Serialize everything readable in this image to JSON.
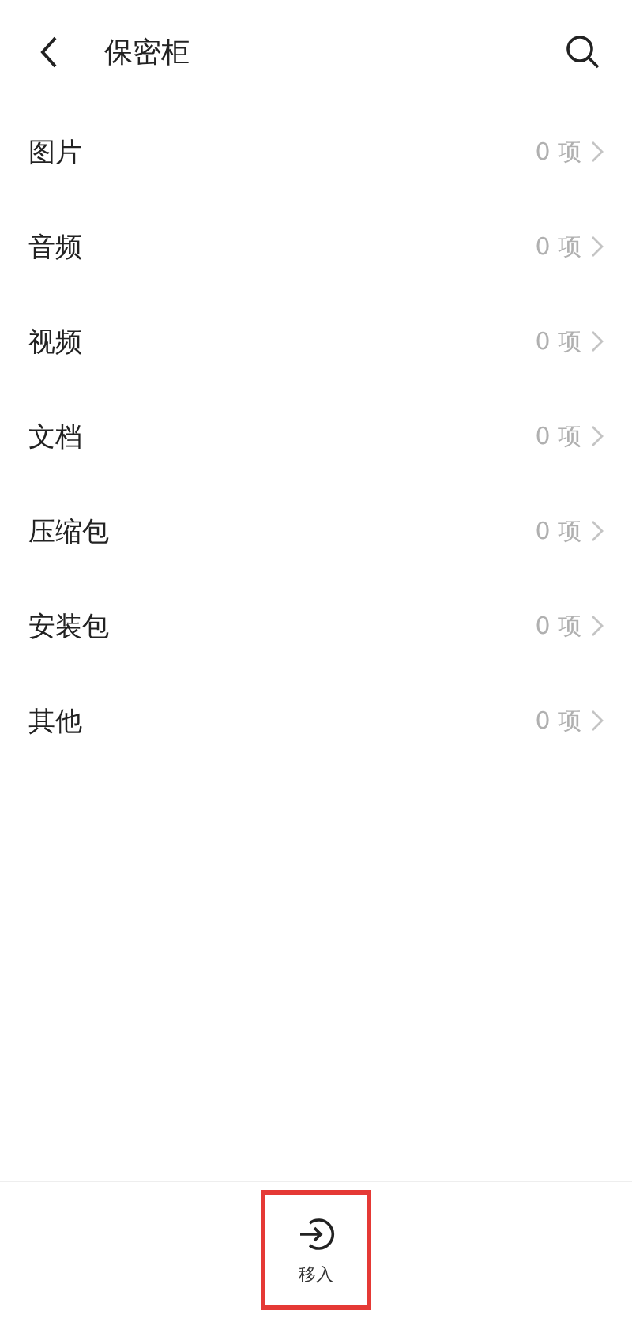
{
  "header": {
    "title": "保密柜"
  },
  "categories": [
    {
      "label": "图片",
      "count": "0 项"
    },
    {
      "label": "音频",
      "count": "0 项"
    },
    {
      "label": "视频",
      "count": "0 项"
    },
    {
      "label": "文档",
      "count": "0 项"
    },
    {
      "label": "压缩包",
      "count": "0 项"
    },
    {
      "label": "安装包",
      "count": "0 项"
    },
    {
      "label": "其他",
      "count": "0 项"
    }
  ],
  "bottom_bar": {
    "action": {
      "label": "移入",
      "highlighted": true
    }
  }
}
